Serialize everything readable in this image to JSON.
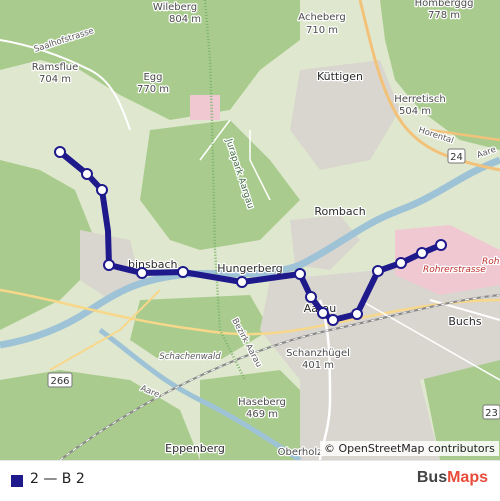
{
  "map": {
    "labels": {
      "wileberg": "Wileberg",
      "wileberg_elev": "804 m",
      "acheberg": "Acheberg",
      "acheberg_elev": "710 m",
      "homberg": "Homberggg",
      "homberg_elev": "778 m",
      "saalhofstrasse": "Saalhofstrasse",
      "ramsflue": "Ramsflue",
      "ramsflue_elev": "704 m",
      "egg": "Egg",
      "egg_elev": "770 m",
      "kuttigen": "Küttigen",
      "herretisch": "Herretisch",
      "herretisch_elev": "504 m",
      "horenstal": "Horental",
      "jurapark": "Jurapark Aargau",
      "rombach": "Rombach",
      "aare_ne": "Aare",
      "badh24": "24",
      "rohrerstrasse": "Rohrerstrasse",
      "rohr": "Rohr",
      "hungerberg": "Hungerberg",
      "binsbach": "binsbach",
      "aarau": "Aarau",
      "buchs": "Buchs",
      "schachenwald": "Schachenwald",
      "bezirk": "Bezirk Aarau",
      "schanzhugel": "Schanzhügel",
      "schanzhugel_elev": "401 m",
      "badge266": "266",
      "aare_sw": "Aare",
      "haseberg": "Haseberg",
      "haseberg_elev": "469 m",
      "badge23": "23",
      "eppenberg": "Eppenberg",
      "oberholz": "Oberholz"
    },
    "route_color": "#1f1a8c",
    "stops": [
      "stop-1",
      "stop-2",
      "stop-3",
      "stop-4",
      "stop-5",
      "stop-6",
      "stop-7",
      "stop-8",
      "stop-9",
      "stop-10",
      "stop-11",
      "stop-12",
      "stop-13",
      "stop-14",
      "stop-15",
      "stop-16"
    ]
  },
  "attribution": "© OpenStreetMap contributors",
  "legend": {
    "route_label": "2 — B 2",
    "swatch_color": "#1f1a8c"
  },
  "brand": {
    "part1": "Bus",
    "part2": "Maps"
  }
}
